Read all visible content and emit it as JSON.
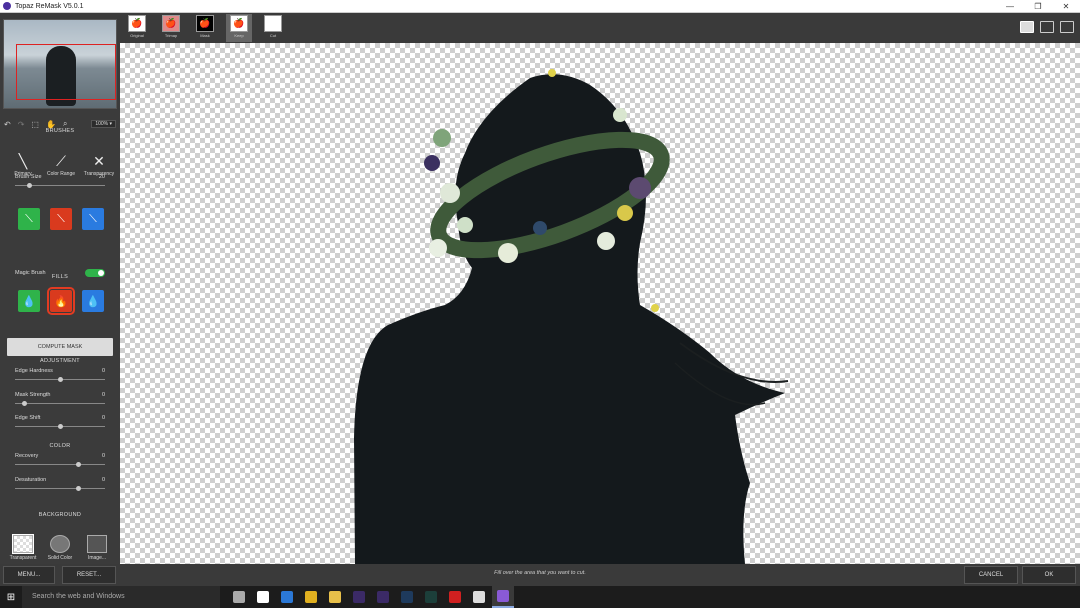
{
  "window": {
    "title": "Topaz ReMask V5.0.1",
    "controls": [
      "—",
      "❐",
      "✕"
    ]
  },
  "view_tabs": [
    {
      "label": "Original",
      "icon": "🍎",
      "color": "#d01010",
      "bg": "#ffffff"
    },
    {
      "label": "Trimap",
      "icon": "🍎",
      "color": "#2fa36a",
      "bg": "#e08a8a"
    },
    {
      "label": "Mask",
      "icon": "🍎",
      "color": "#ffffff",
      "bg": "#000000"
    },
    {
      "label": "Keep",
      "icon": "🍎",
      "color": "#d01010",
      "bg": "#ffffff"
    },
    {
      "label": "Cut",
      "icon": "",
      "color": "#cccccc",
      "bg": "#ffffff"
    }
  ],
  "tools": {
    "zoom": "100% ▾"
  },
  "brushes": {
    "title": "BRUSHES",
    "items": [
      {
        "label": "Primary",
        "icon": "╲"
      },
      {
        "label": "Color Range",
        "icon": "⟋"
      },
      {
        "label": "Transparency",
        "icon": "✕"
      }
    ],
    "size_label": "Brush Size",
    "size_value": "20",
    "size_fraction": 0.15
  },
  "magic_brush": {
    "label": "Magic Brush",
    "on": true
  },
  "fills": {
    "title": "FILLS"
  },
  "compute_label": "COMPUTE MASK",
  "adjustment": {
    "title": "ADJUSTMENT",
    "sliders": [
      {
        "label": "Edge Hardness",
        "value": "0",
        "fraction": 0.5
      },
      {
        "label": "Mask Strength",
        "value": "0",
        "fraction": 0.1
      },
      {
        "label": "Edge Shift",
        "value": "0",
        "fraction": 0.5
      }
    ]
  },
  "color": {
    "title": "COLOR",
    "sliders": [
      {
        "label": "Recovery",
        "value": "0",
        "fraction": 0.7
      },
      {
        "label": "Desaturation",
        "value": "0",
        "fraction": 0.7
      }
    ]
  },
  "background": {
    "title": "BACKGROUND",
    "options": [
      "Transparent",
      "Solid Color",
      "Image..."
    ]
  },
  "footer": {
    "menu": "MENU...",
    "reset": "RESET...",
    "hint": "Fill over the area that you want to cut.",
    "cancel": "CANCEL",
    "ok": "OK"
  },
  "taskbar": {
    "search": "Search the web and Windows",
    "apps": [
      {
        "icon": "task-view-icon",
        "color": "#aaaaaa"
      },
      {
        "icon": "store-icon",
        "color": "#ffffff"
      },
      {
        "icon": "edge-icon",
        "color": "#2b78d6"
      },
      {
        "icon": "chrome-icon",
        "color": "#e0b020"
      },
      {
        "icon": "explorer-icon",
        "color": "#e8c04a"
      },
      {
        "icon": "after-effects-icon",
        "color": "#3b2a66"
      },
      {
        "icon": "premiere-icon",
        "color": "#3b2a66"
      },
      {
        "icon": "photoshop-icon",
        "color": "#1e3a5c"
      },
      {
        "icon": "media-encoder-icon",
        "color": "#1c3f3a"
      },
      {
        "icon": "record-icon",
        "color": "#d02020"
      },
      {
        "icon": "photos-icon",
        "color": "#dddddd"
      },
      {
        "icon": "visual-studio-icon",
        "color": "#8a5ad6"
      }
    ]
  }
}
